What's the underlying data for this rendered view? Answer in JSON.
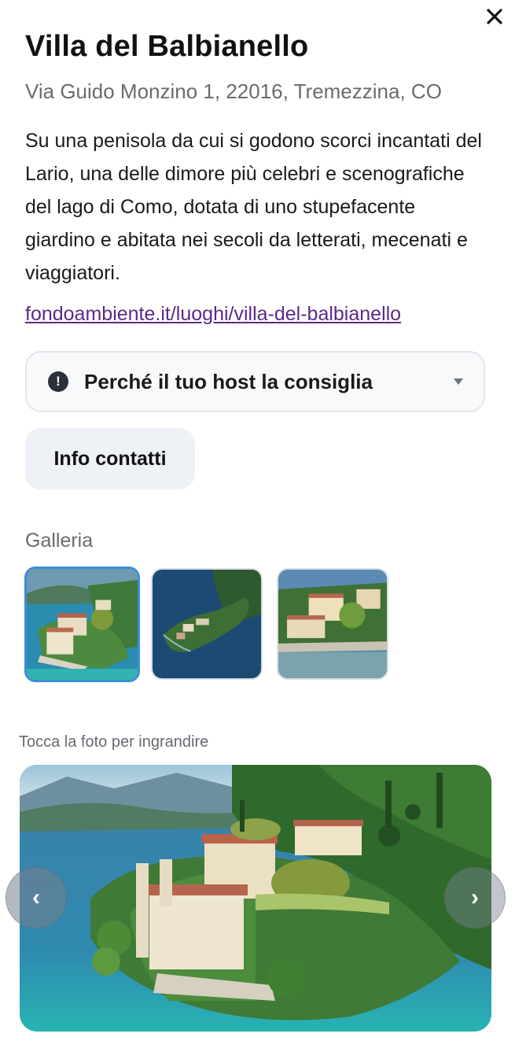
{
  "header": {
    "title": "Villa del Balbianello",
    "address": "Via Guido Monzino 1, 22016, Tremezzina, CO",
    "description": "Su una penisola da cui si godono scorci incantati del Lario, una delle dimore più celebri e scenografiche del lago di Como, dotata di uno stupefacente giardino e abitata nei secoli da letterati, mecenati e viaggiatori.",
    "link": "fondoambiente.it/luoghi/villa-del-balbianello"
  },
  "accordion": {
    "icon": "exclamation-circle-icon",
    "label": "Perché il tuo host la consiglia",
    "expanded": false
  },
  "contact_button": {
    "label": "Info contatti"
  },
  "gallery": {
    "label": "Galleria",
    "thumbnails": [
      {
        "name": "villa-aerial-photo",
        "selected": true
      },
      {
        "name": "peninsula-aerial-photo",
        "selected": false
      },
      {
        "name": "villa-lakeside-photo",
        "selected": false
      }
    ]
  },
  "viewer": {
    "hint": "Tocca la foto per ingrandire",
    "prev_label": "‹",
    "next_label": "›"
  },
  "colors": {
    "link": "#5b2a86",
    "selected_border": "#3b8ed6",
    "lake": "#2f7fb3"
  }
}
